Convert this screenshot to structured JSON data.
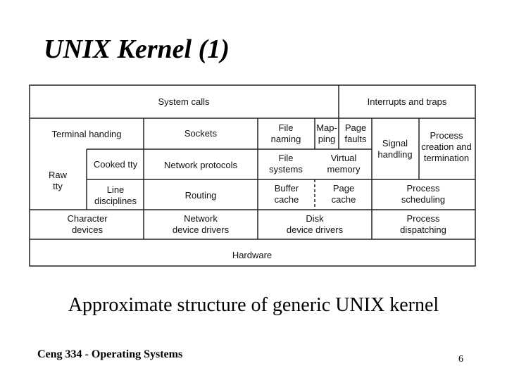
{
  "slide": {
    "title": "UNIX Kernel (1)",
    "caption": "Approximate structure of generic UNIX kernel",
    "footer": "Ceng 334 - Operating Systems",
    "page_number": "6"
  },
  "diagram": {
    "cells": [
      {
        "id": "system-calls",
        "lines": [
          "System calls"
        ]
      },
      {
        "id": "interrupts-and-traps",
        "lines": [
          "Interrupts and traps"
        ]
      },
      {
        "id": "terminal-handling",
        "lines": [
          "Terminal handing"
        ]
      },
      {
        "id": "sockets",
        "lines": [
          "Sockets"
        ]
      },
      {
        "id": "file-naming",
        "lines": [
          "File",
          "naming"
        ]
      },
      {
        "id": "mapping",
        "lines": [
          "Map-",
          "ping"
        ]
      },
      {
        "id": "page-faults",
        "lines": [
          "Page",
          "faults"
        ]
      },
      {
        "id": "signal-handling",
        "lines": [
          "Signal",
          "handling"
        ]
      },
      {
        "id": "process-creation",
        "lines": [
          "Process",
          "creation and",
          "termination"
        ]
      },
      {
        "id": "raw-tty",
        "lines": [
          "Raw",
          "tty"
        ]
      },
      {
        "id": "cooked-tty",
        "lines": [
          "Cooked tty"
        ]
      },
      {
        "id": "network-protocols",
        "lines": [
          "Network protocols"
        ]
      },
      {
        "id": "file-systems",
        "lines": [
          "File",
          "systems"
        ]
      },
      {
        "id": "virtual-memory",
        "lines": [
          "Virtual",
          "memory"
        ]
      },
      {
        "id": "line-disciplines",
        "lines": [
          "Line",
          "disciplines"
        ]
      },
      {
        "id": "routing",
        "lines": [
          "Routing"
        ]
      },
      {
        "id": "buffer-cache",
        "lines": [
          "Buffer",
          "cache"
        ]
      },
      {
        "id": "page-cache",
        "lines": [
          "Page",
          "cache"
        ]
      },
      {
        "id": "process-scheduling",
        "lines": [
          "Process",
          "scheduling"
        ]
      },
      {
        "id": "character-devices",
        "lines": [
          "Character",
          "devices"
        ]
      },
      {
        "id": "network-device-drivers",
        "lines": [
          "Network",
          "device drivers"
        ]
      },
      {
        "id": "disk-device-drivers",
        "lines": [
          "Disk",
          "device drivers"
        ]
      },
      {
        "id": "process-dispatching",
        "lines": [
          "Process",
          "dispatching"
        ]
      },
      {
        "id": "hardware",
        "lines": [
          "Hardware"
        ]
      }
    ]
  }
}
